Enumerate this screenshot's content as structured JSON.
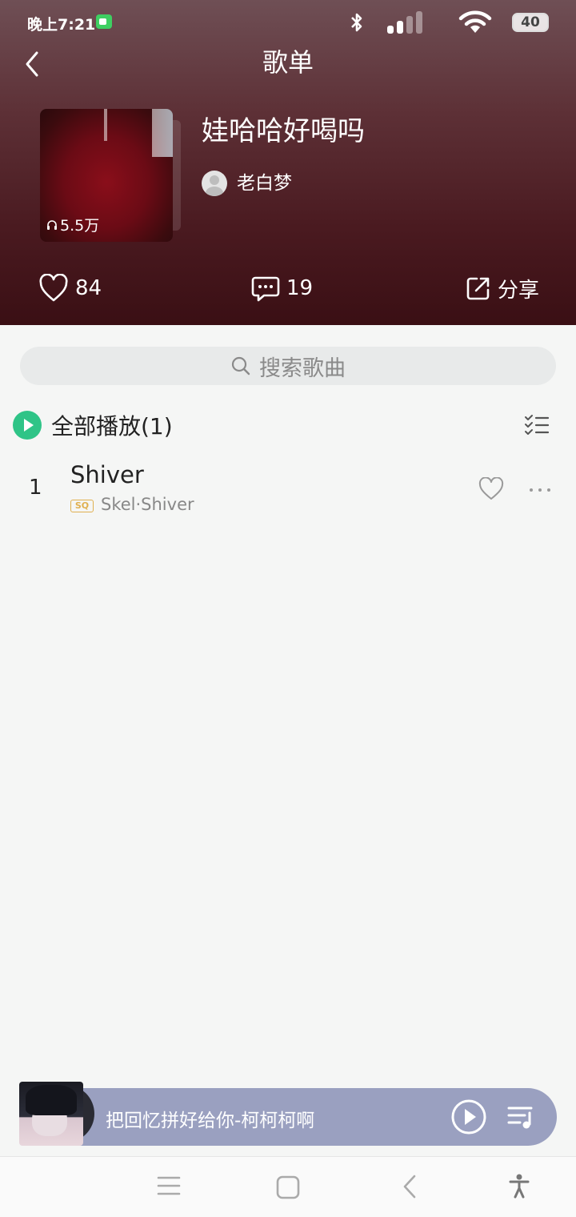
{
  "status_bar": {
    "time": "晚上7:21",
    "battery": "40",
    "icons": [
      "video-call-icon",
      "bluetooth-icon",
      "signal-icon",
      "wifi-icon",
      "battery-icon"
    ]
  },
  "header": {
    "title": "歌单",
    "back_icon": "chevron-left-icon"
  },
  "playlist": {
    "name": "娃哈哈好喝吗",
    "play_count": "5.5万",
    "creator": "老白梦",
    "likes": "84",
    "comments": "19",
    "share_label": "分享"
  },
  "search": {
    "placeholder": "搜索歌曲"
  },
  "play_all": {
    "label": "全部播放(1)"
  },
  "songs": [
    {
      "index": "1",
      "title": "Shiver",
      "quality": "SQ",
      "subtitle": "Skel·Shiver"
    }
  ],
  "mini_player": {
    "title": "把回忆拼好给你-柯柯柯啊"
  },
  "colors": {
    "accent": "#2fc487",
    "header_bg": "#4a1a20",
    "mini_player_bg": "#9aa0c0",
    "sq_badge": "#e0b050"
  }
}
